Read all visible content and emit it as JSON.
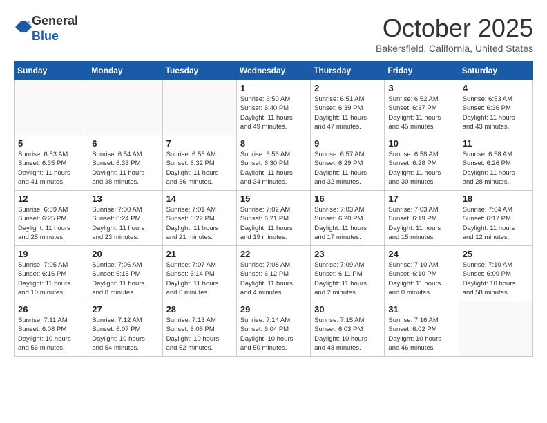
{
  "logo": {
    "general": "General",
    "blue": "Blue"
  },
  "title": "October 2025",
  "location": "Bakersfield, California, United States",
  "days_header": [
    "Sunday",
    "Monday",
    "Tuesday",
    "Wednesday",
    "Thursday",
    "Friday",
    "Saturday"
  ],
  "weeks": [
    [
      {
        "day": "",
        "info": ""
      },
      {
        "day": "",
        "info": ""
      },
      {
        "day": "",
        "info": ""
      },
      {
        "day": "1",
        "info": "Sunrise: 6:50 AM\nSunset: 6:40 PM\nDaylight: 11 hours\nand 49 minutes."
      },
      {
        "day": "2",
        "info": "Sunrise: 6:51 AM\nSunset: 6:39 PM\nDaylight: 11 hours\nand 47 minutes."
      },
      {
        "day": "3",
        "info": "Sunrise: 6:52 AM\nSunset: 6:37 PM\nDaylight: 11 hours\nand 45 minutes."
      },
      {
        "day": "4",
        "info": "Sunrise: 6:53 AM\nSunset: 6:36 PM\nDaylight: 11 hours\nand 43 minutes."
      }
    ],
    [
      {
        "day": "5",
        "info": "Sunrise: 6:53 AM\nSunset: 6:35 PM\nDaylight: 11 hours\nand 41 minutes."
      },
      {
        "day": "6",
        "info": "Sunrise: 6:54 AM\nSunset: 6:33 PM\nDaylight: 11 hours\nand 38 minutes."
      },
      {
        "day": "7",
        "info": "Sunrise: 6:55 AM\nSunset: 6:32 PM\nDaylight: 11 hours\nand 36 minutes."
      },
      {
        "day": "8",
        "info": "Sunrise: 6:56 AM\nSunset: 6:30 PM\nDaylight: 11 hours\nand 34 minutes."
      },
      {
        "day": "9",
        "info": "Sunrise: 6:57 AM\nSunset: 6:29 PM\nDaylight: 11 hours\nand 32 minutes."
      },
      {
        "day": "10",
        "info": "Sunrise: 6:58 AM\nSunset: 6:28 PM\nDaylight: 11 hours\nand 30 minutes."
      },
      {
        "day": "11",
        "info": "Sunrise: 6:58 AM\nSunset: 6:26 PM\nDaylight: 11 hours\nand 28 minutes."
      }
    ],
    [
      {
        "day": "12",
        "info": "Sunrise: 6:59 AM\nSunset: 6:25 PM\nDaylight: 11 hours\nand 25 minutes."
      },
      {
        "day": "13",
        "info": "Sunrise: 7:00 AM\nSunset: 6:24 PM\nDaylight: 11 hours\nand 23 minutes."
      },
      {
        "day": "14",
        "info": "Sunrise: 7:01 AM\nSunset: 6:22 PM\nDaylight: 11 hours\nand 21 minutes."
      },
      {
        "day": "15",
        "info": "Sunrise: 7:02 AM\nSunset: 6:21 PM\nDaylight: 11 hours\nand 19 minutes."
      },
      {
        "day": "16",
        "info": "Sunrise: 7:03 AM\nSunset: 6:20 PM\nDaylight: 11 hours\nand 17 minutes."
      },
      {
        "day": "17",
        "info": "Sunrise: 7:03 AM\nSunset: 6:19 PM\nDaylight: 11 hours\nand 15 minutes."
      },
      {
        "day": "18",
        "info": "Sunrise: 7:04 AM\nSunset: 6:17 PM\nDaylight: 11 hours\nand 12 minutes."
      }
    ],
    [
      {
        "day": "19",
        "info": "Sunrise: 7:05 AM\nSunset: 6:16 PM\nDaylight: 11 hours\nand 10 minutes."
      },
      {
        "day": "20",
        "info": "Sunrise: 7:06 AM\nSunset: 6:15 PM\nDaylight: 11 hours\nand 8 minutes."
      },
      {
        "day": "21",
        "info": "Sunrise: 7:07 AM\nSunset: 6:14 PM\nDaylight: 11 hours\nand 6 minutes."
      },
      {
        "day": "22",
        "info": "Sunrise: 7:08 AM\nSunset: 6:12 PM\nDaylight: 11 hours\nand 4 minutes."
      },
      {
        "day": "23",
        "info": "Sunrise: 7:09 AM\nSunset: 6:11 PM\nDaylight: 11 hours\nand 2 minutes."
      },
      {
        "day": "24",
        "info": "Sunrise: 7:10 AM\nSunset: 6:10 PM\nDaylight: 11 hours\nand 0 minutes."
      },
      {
        "day": "25",
        "info": "Sunrise: 7:10 AM\nSunset: 6:09 PM\nDaylight: 10 hours\nand 58 minutes."
      }
    ],
    [
      {
        "day": "26",
        "info": "Sunrise: 7:11 AM\nSunset: 6:08 PM\nDaylight: 10 hours\nand 56 minutes."
      },
      {
        "day": "27",
        "info": "Sunrise: 7:12 AM\nSunset: 6:07 PM\nDaylight: 10 hours\nand 54 minutes."
      },
      {
        "day": "28",
        "info": "Sunrise: 7:13 AM\nSunset: 6:05 PM\nDaylight: 10 hours\nand 52 minutes."
      },
      {
        "day": "29",
        "info": "Sunrise: 7:14 AM\nSunset: 6:04 PM\nDaylight: 10 hours\nand 50 minutes."
      },
      {
        "day": "30",
        "info": "Sunrise: 7:15 AM\nSunset: 6:03 PM\nDaylight: 10 hours\nand 48 minutes."
      },
      {
        "day": "31",
        "info": "Sunrise: 7:16 AM\nSunset: 6:02 PM\nDaylight: 10 hours\nand 46 minutes."
      },
      {
        "day": "",
        "info": ""
      }
    ]
  ]
}
